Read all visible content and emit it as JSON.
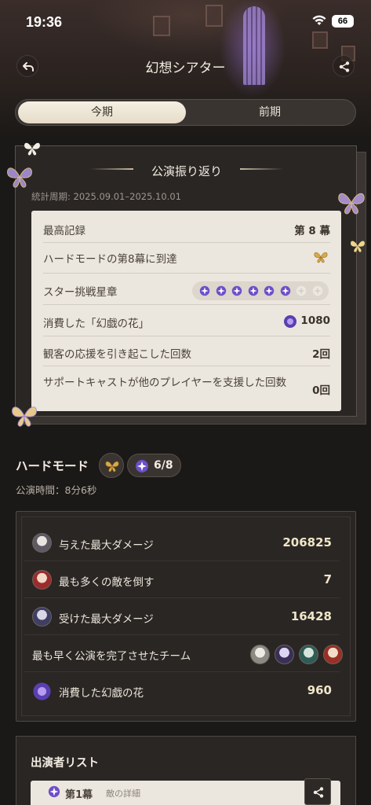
{
  "status_bar": {
    "time": "19:36",
    "battery": "66"
  },
  "header": {
    "title": "幻想シアター",
    "back_icon": "back-arrow-icon",
    "share_icon": "share-icon"
  },
  "tabs": {
    "current": "今期",
    "previous": "前期"
  },
  "review": {
    "title": "公演振り返り",
    "period": "統計周期: 2025.09.01–2025.10.01",
    "best_record": {
      "label": "最高記録",
      "value": "第 8 幕"
    },
    "hard_mode": {
      "label": "ハードモードの第8幕に到達"
    },
    "star_medal": {
      "label": "スター挑戦星章",
      "filled": 6,
      "total": 8
    },
    "flowers": {
      "label": "消費した「幻戯の花」",
      "value": "1080"
    },
    "audience": {
      "label": "観客の応援を引き起こした回数",
      "value": "2回"
    },
    "support": {
      "label": "サポートキャストが他のプレイヤーを支援した回数",
      "value": "0回"
    }
  },
  "hard_mode": {
    "title": "ハードモード",
    "stars": "6/8",
    "time": "公演時間：8分6秒",
    "rows": [
      {
        "label": "与えた最大ダメージ",
        "value": "206825"
      },
      {
        "label": "最も多くの敵を倒す",
        "value": "7"
      },
      {
        "label": "受けた最大ダメージ",
        "value": "16428"
      },
      {
        "label": "最も早く公演を完了させたチーム",
        "value": ""
      },
      {
        "label": "消費した幻戯の花",
        "value": "960"
      }
    ]
  },
  "cast": {
    "title": "出演者リスト",
    "act": "第1幕",
    "detail": "敵の詳細"
  },
  "colors": {
    "accent": "#e6dcc7",
    "star": "#6c4fc9",
    "background": "#1b1917"
  }
}
